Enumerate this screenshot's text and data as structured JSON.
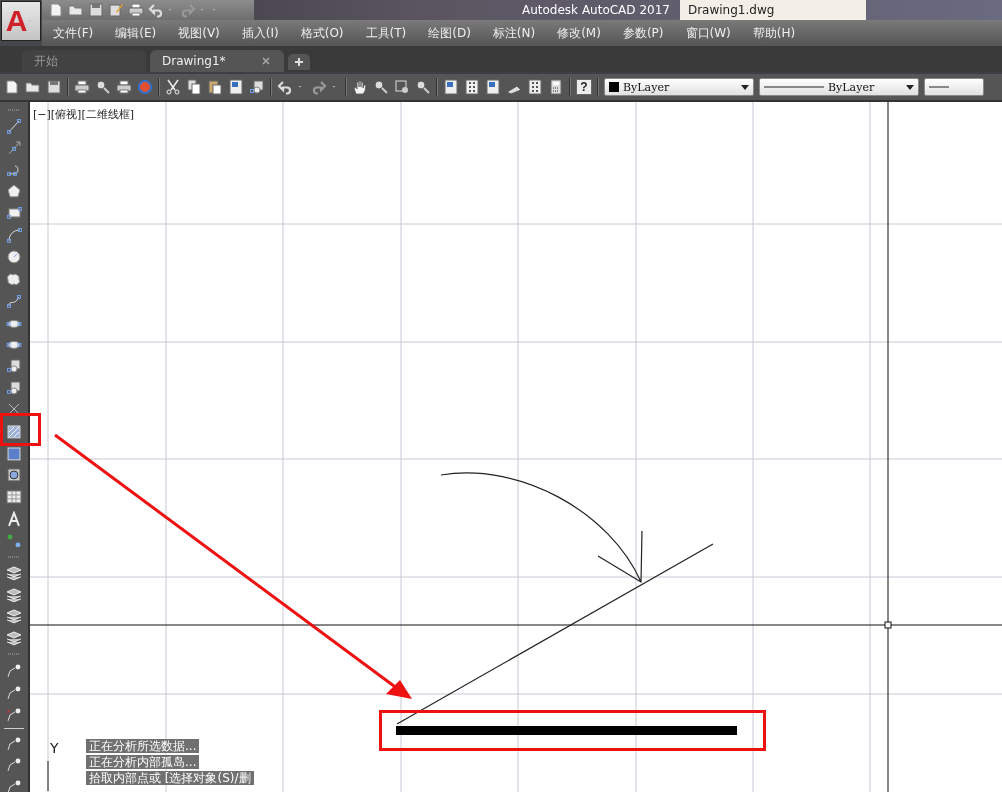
{
  "app_logo": "A",
  "title_bar": {
    "app_title": "Autodesk AutoCAD 2017",
    "document_title": "Drawing1.dwg"
  },
  "menu": [
    "文件(F)",
    "编辑(E)",
    "视图(V)",
    "插入(I)",
    "格式(O)",
    "工具(T)",
    "绘图(D)",
    "标注(N)",
    "修改(M)",
    "参数(P)",
    "窗口(W)",
    "帮助(H)"
  ],
  "tabs": [
    {
      "label": "开始",
      "selected": false
    },
    {
      "label": "Drawing1*",
      "selected": true
    }
  ],
  "toolbar": {
    "help_button": "?",
    "color_dropdown": "ByLayer",
    "linetype_dropdown": "ByLayer"
  },
  "viewport": {
    "label": "[−][俯视][二维线框]",
    "axis_label": "Y"
  },
  "command_history": [
    "正在分析所选数据...",
    "正在分析内部孤岛...",
    "拾取内部点或 [选择对象(S)/删"
  ]
}
